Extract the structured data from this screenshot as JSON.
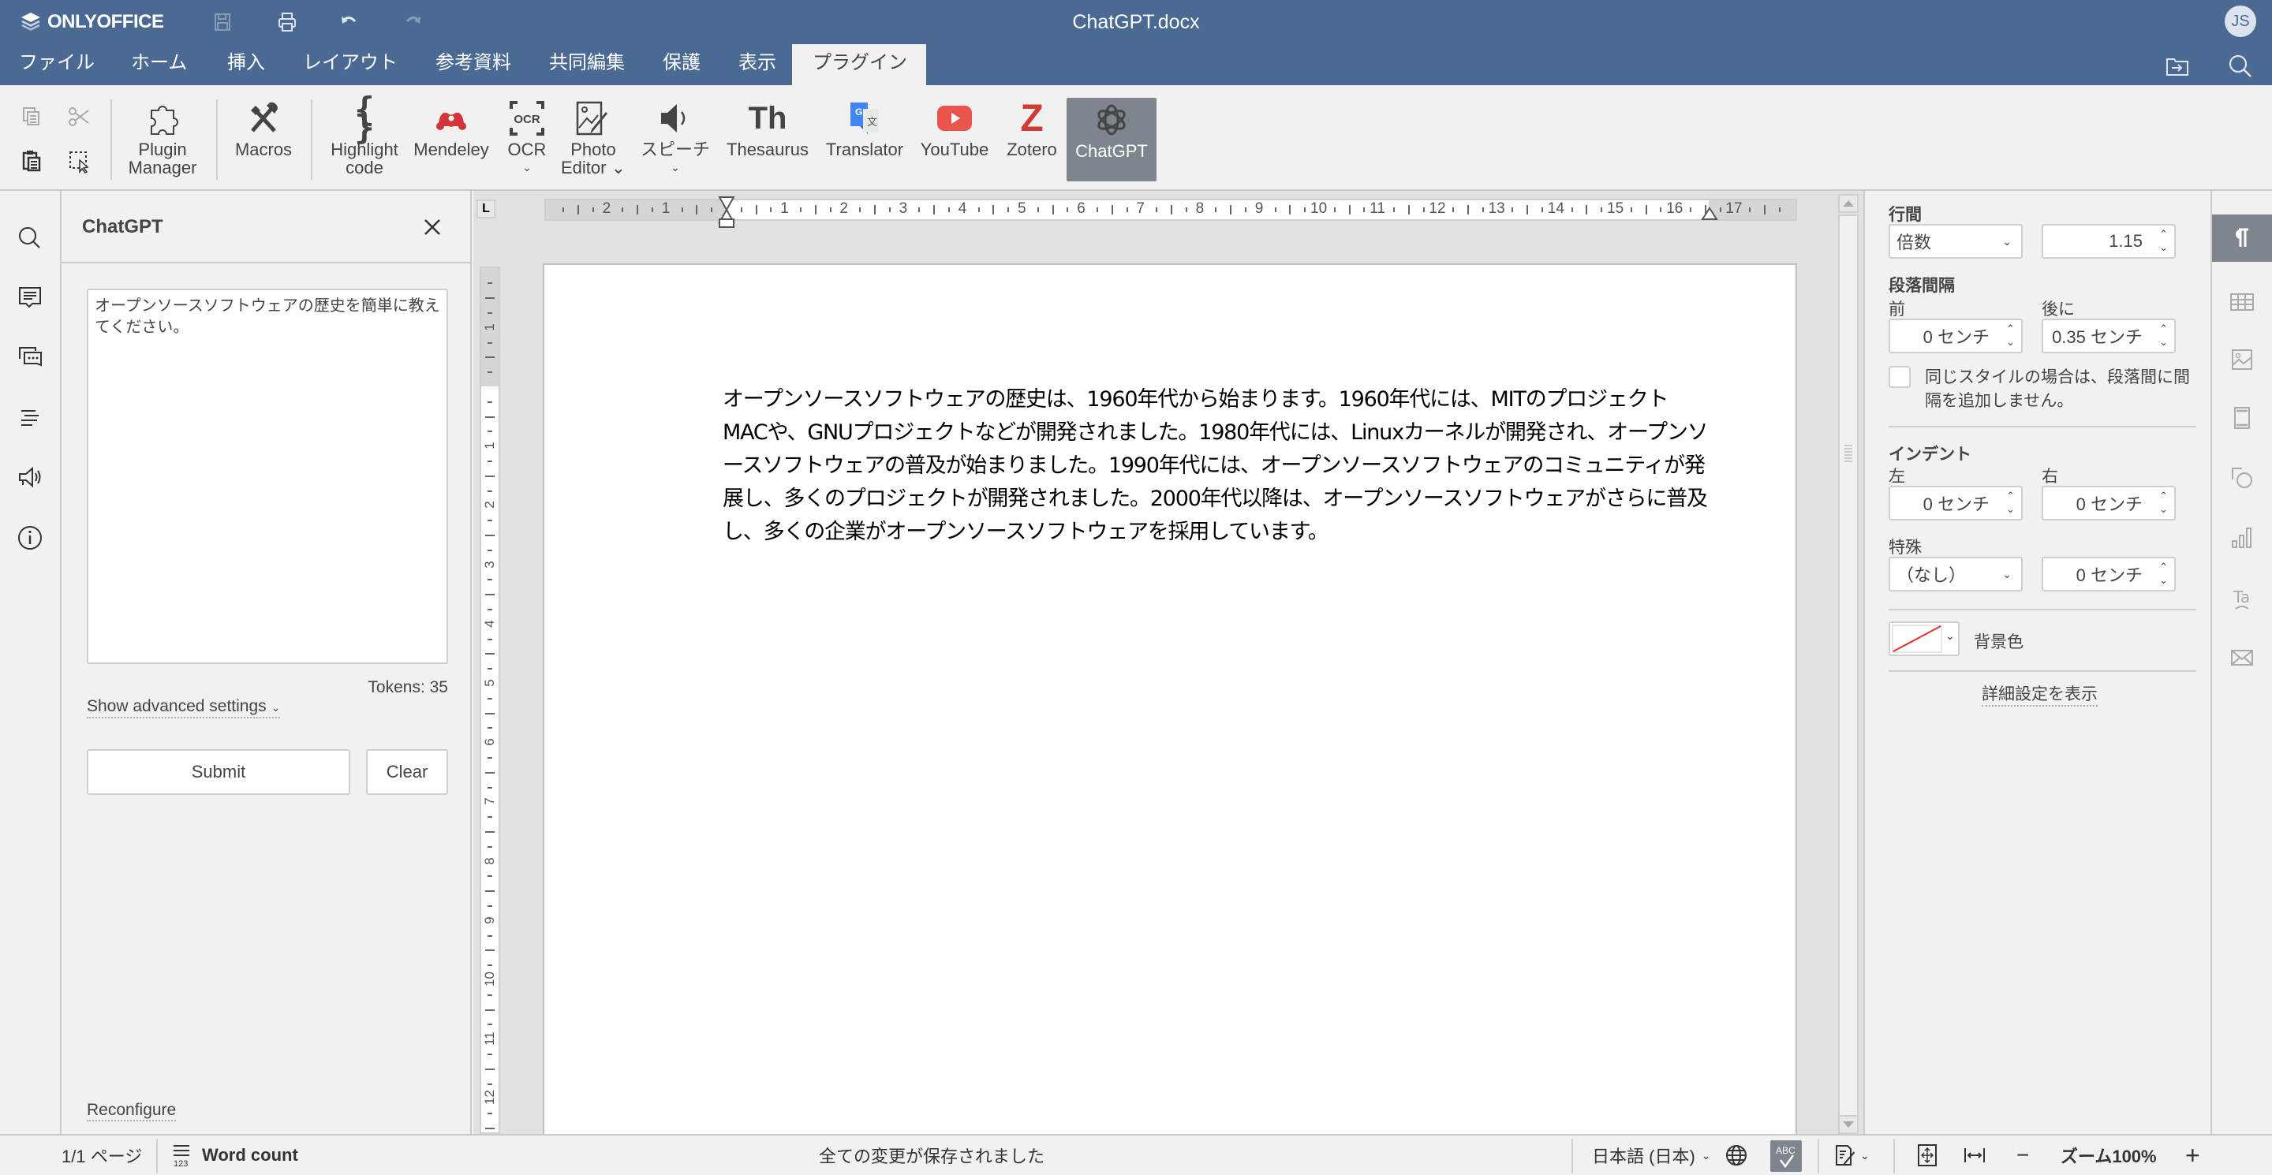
{
  "app": {
    "brand": "ONLYOFFICE",
    "document_title": "ChatGPT.docx",
    "user_initials": "JS",
    "accent_color": "#4a6a94"
  },
  "quick_access": [
    {
      "icon": "save-icon"
    },
    {
      "icon": "print-icon"
    },
    {
      "icon": "undo-icon"
    },
    {
      "icon": "redo-icon"
    }
  ],
  "menu_tabs": [
    {
      "label": "ファイル"
    },
    {
      "label": "ホーム"
    },
    {
      "label": "挿入"
    },
    {
      "label": "レイアウト"
    },
    {
      "label": "参考資料"
    },
    {
      "label": "共同編集"
    },
    {
      "label": "保護"
    },
    {
      "label": "表示"
    },
    {
      "label": "プラグイン",
      "active": true
    }
  ],
  "toolbar": {
    "buttons": [
      {
        "id": "plugin-manager",
        "label_line1": "Plugin",
        "label_line2": "Manager"
      },
      {
        "id": "macros",
        "label_line1": "Macros",
        "label_line2": ""
      },
      {
        "id": "highlight-code",
        "label_line1": "Highlight",
        "label_line2": "code"
      },
      {
        "id": "mendeley",
        "label_line1": "Mendeley",
        "label_line2": ""
      },
      {
        "id": "ocr",
        "label_line1": "OCR",
        "label_line2": "⌄"
      },
      {
        "id": "photo-editor",
        "label_line1": "Photo",
        "label_line2": "Editor ⌄"
      },
      {
        "id": "speech",
        "label_line1": "スピーチ",
        "label_line2": "⌄"
      },
      {
        "id": "thesaurus",
        "label_line1": "Thesaurus",
        "label_line2": ""
      },
      {
        "id": "translator",
        "label_line1": "Translator",
        "label_line2": ""
      },
      {
        "id": "youtube",
        "label_line1": "YouTube",
        "label_line2": ""
      },
      {
        "id": "zotero",
        "label_line1": "Zotero",
        "label_line2": ""
      },
      {
        "id": "chatgpt",
        "label_line1": "ChatGPT",
        "label_line2": "",
        "active": true
      }
    ]
  },
  "plugin_panel": {
    "title": "ChatGPT",
    "prompt_value": "オープンソースソフトウェアの歴史を簡単に教えてください。",
    "tokens_label": "Tokens: 35",
    "advanced_label": "Show advanced settings",
    "submit_label": "Submit",
    "clear_label": "Clear",
    "reconfigure_label": "Reconfigure"
  },
  "ruler": {
    "horizontal_left_numbers": [
      "2",
      "1"
    ],
    "horizontal_numbers": [
      "1",
      "2",
      "3",
      "4",
      "5",
      "6",
      "7",
      "8",
      "9",
      "10",
      "11",
      "12",
      "13",
      "14",
      "15",
      "16",
      "17"
    ],
    "vertical_top_numbers": [
      "1"
    ],
    "vertical_numbers": [
      "1",
      "2",
      "3",
      "4",
      "5",
      "6",
      "7",
      "8",
      "9",
      "10",
      "11",
      "12"
    ]
  },
  "document": {
    "paragraph": "オープンソースソフトウェアの歴史は、1960年代から始まります。1960年代には、MITのプロジェクトMACや、GNUプロジェクトなどが開発されました。1980年代には、Linuxカーネルが開発され、オープンソースソフトウェアの普及が始まりました。1990年代には、オープンソースソフトウェアのコミュニティが発展し、多くのプロジェクトが開発されました。2000年代以降は、オープンソースソフトウェアがさらに普及し、多くの企業がオープンソースソフトウェアを採用しています。"
  },
  "paragraph_settings": {
    "line_spacing_label": "行間",
    "line_spacing_type": "倍数",
    "line_spacing_value": "1.15",
    "para_spacing_label": "段落間隔",
    "before_label": "前",
    "before_value": "0 センチ",
    "after_label": "後に",
    "after_value": "0.35 センチ",
    "no_space_same_style_label": "同じスタイルの場合は、段落間に間隔を追加しません。",
    "no_space_same_style_checked": false,
    "indent_label": "インデント",
    "left_label": "左",
    "left_value": "0 センチ",
    "right_label": "右",
    "right_value": "0 センチ",
    "special_label": "特殊",
    "special_type": "（なし）",
    "special_value": "0 センチ",
    "bg_color_label": "背景色",
    "bg_color_value": "none",
    "advanced_label": "詳細設定を表示"
  },
  "right_rail": [
    {
      "icon": "paragraph-icon",
      "active": true
    },
    {
      "icon": "table-icon"
    },
    {
      "icon": "image-icon"
    },
    {
      "icon": "header-footer-icon"
    },
    {
      "icon": "shape-icon"
    },
    {
      "icon": "chart-icon"
    },
    {
      "icon": "text-art-icon"
    },
    {
      "icon": "mail-merge-icon"
    }
  ],
  "left_rail": [
    {
      "icon": "search-icon"
    },
    {
      "icon": "comments-icon"
    },
    {
      "icon": "chat-icon"
    },
    {
      "icon": "navigation-icon"
    },
    {
      "icon": "feedback-icon"
    },
    {
      "icon": "about-icon"
    }
  ],
  "statusbar": {
    "page_info": "1/1 ページ",
    "word_count_label": "Word count",
    "save_status": "全ての変更が保存されました",
    "language": "日本語 (日本)",
    "zoom_label": "ズーム100%"
  }
}
